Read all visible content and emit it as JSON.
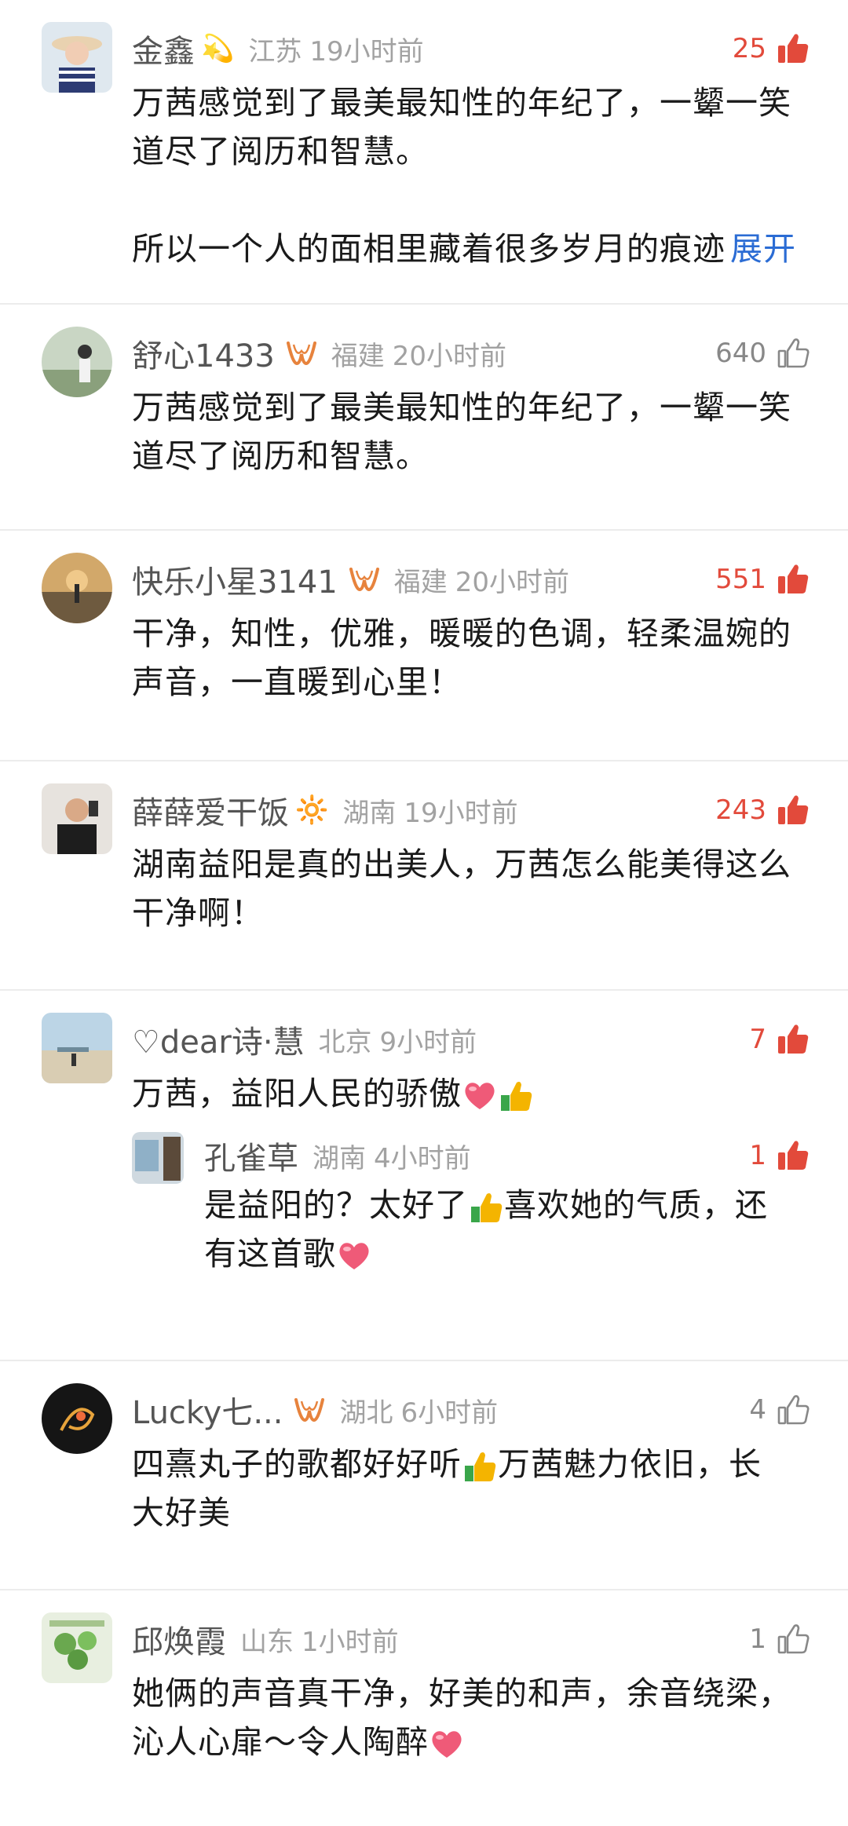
{
  "comments": [
    {
      "name": "金鑫",
      "badge": "💫",
      "location": "江苏",
      "time": "19小时前",
      "likes": "25",
      "liked": true,
      "lines": [
        "万茜感觉到了最美最知性的年纪了，一颦一笑",
        "道尽了阅历和智慧。"
      ],
      "line3": "所以一个人的面相里藏着很多岁月的痕迹",
      "expand": "展开"
    },
    {
      "name": "舒心1433",
      "location": "福建",
      "time": "20小时前",
      "likes": "640",
      "liked": false,
      "lines": [
        "万茜感觉到了最美最知性的年纪了，一颦一笑",
        "道尽了阅历和智慧。"
      ]
    },
    {
      "name": "快乐小星3141",
      "location": "福建",
      "time": "20小时前",
      "likes": "551",
      "liked": true,
      "lines": [
        "干净，知性，优雅，暖暖的色调，轻柔温婉的",
        "声音，一直暖到心里！"
      ]
    },
    {
      "name": "薛薛爱干饭",
      "badge": "🔆",
      "location": "湖南",
      "time": "19小时前",
      "likes": "243",
      "liked": true,
      "lines": [
        "湖南益阳是真的出美人，万茜怎么能美得这么",
        "干净啊！"
      ]
    },
    {
      "name": "♡dear诗·慧",
      "location": "北京",
      "time": "9小时前",
      "likes": "7",
      "liked": true,
      "line1": "万茜，益阳人民的骄傲",
      "reply": {
        "name": "孔雀草",
        "location": "湖南",
        "time": "4小时前",
        "likes": "1",
        "line1a": "是益阳的？太好了",
        "line1b": "喜欢她的气质，还",
        "line2": "有这首歌"
      }
    },
    {
      "name": "Lucky七...",
      "location": "湖北",
      "time": "6小时前",
      "likes": "4",
      "liked": false,
      "line1a": "四熹丸子的歌都好好听",
      "line1b": "万茜魅力依旧，长",
      "line2": "大好美"
    },
    {
      "name": "邱焕霞",
      "location": "山东",
      "time": "1小时前",
      "likes": "1",
      "liked": false,
      "line1": "她俩的声音真干净，好美的和声，余音绕梁，",
      "line2": "沁人心扉～令人陶醉"
    }
  ],
  "colors": {
    "hot": "#e24a3b",
    "muted": "#a2a2a2",
    "link": "#2b6cd4"
  },
  "icons": [
    "thumbs-up-filled-icon",
    "thumbs-up-outline-icon",
    "verified-w-badge-icon",
    "heart-emoji",
    "thumbs-up-emoji"
  ]
}
